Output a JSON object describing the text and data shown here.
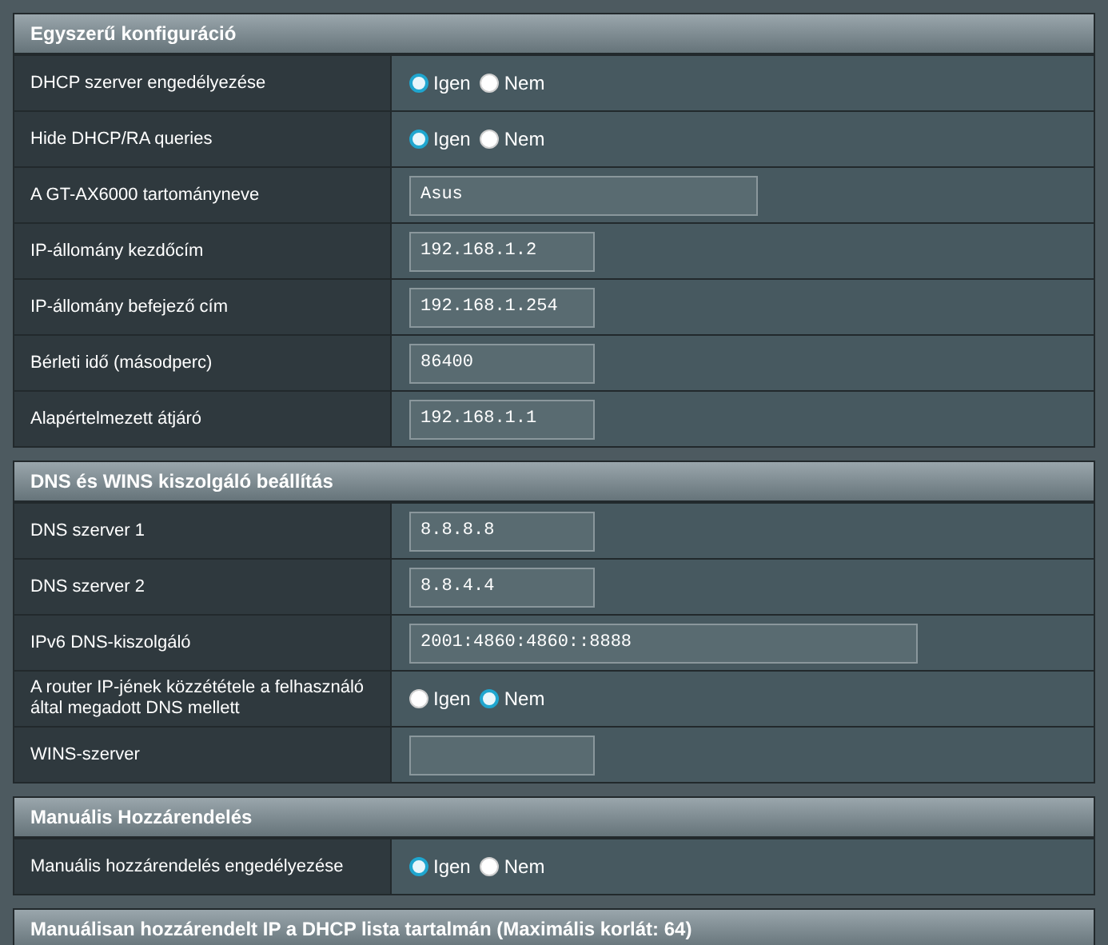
{
  "sections": [
    {
      "title": "Egyszerű konfiguráció",
      "rows": [
        {
          "label": "DHCP szerver engedélyezése",
          "kind": "radio",
          "options": [
            {
              "label": "Igen",
              "selected": true
            },
            {
              "label": "Nem",
              "selected": false
            }
          ]
        },
        {
          "label": "Hide DHCP/RA queries",
          "kind": "radio",
          "options": [
            {
              "label": "Igen",
              "selected": true
            },
            {
              "label": "Nem",
              "selected": false
            }
          ]
        },
        {
          "label": "A GT-AX6000 tartományneve",
          "kind": "field_medium",
          "value": "Asus"
        },
        {
          "label": "IP-állomány kezdőcím",
          "kind": "field_short",
          "value": "192.168.1.2"
        },
        {
          "label": "IP-állomány befejező cím",
          "kind": "field_short",
          "value": "192.168.1.254"
        },
        {
          "label": "Bérleti idő (másodperc)",
          "kind": "field_short",
          "value": "86400"
        },
        {
          "label": "Alapértelmezett átjáró",
          "kind": "field_short",
          "value": "192.168.1.1"
        }
      ]
    },
    {
      "title": "DNS és WINS kiszolgáló beállítás",
      "rows": [
        {
          "label": "DNS szerver 1",
          "kind": "field_short",
          "value": "8.8.8.8"
        },
        {
          "label": "DNS szerver 2",
          "kind": "field_short",
          "value": "8.8.4.4"
        },
        {
          "label": "IPv6 DNS-kiszolgáló",
          "kind": "field_long",
          "value": "2001:4860:4860::8888"
        },
        {
          "label": "A router IP-jének közzététele a felhasználó által megadott DNS mellett",
          "kind": "radio",
          "options": [
            {
              "label": "Igen",
              "selected": false
            },
            {
              "label": "Nem",
              "selected": true
            }
          ]
        },
        {
          "label": "WINS-szerver",
          "kind": "field_short"
        }
      ]
    },
    {
      "title": "Manuális Hozzárendelés",
      "rows": [
        {
          "label": "Manuális hozzárendelés engedélyezése",
          "kind": "radio",
          "options": [
            {
              "label": "Igen",
              "selected": true
            },
            {
              "label": "Nem",
              "selected": false
            }
          ]
        }
      ]
    },
    {
      "title": "Manuálisan hozzárendelt IP a DHCP lista tartalmán (Maximális korlát: 64)"
    }
  ]
}
